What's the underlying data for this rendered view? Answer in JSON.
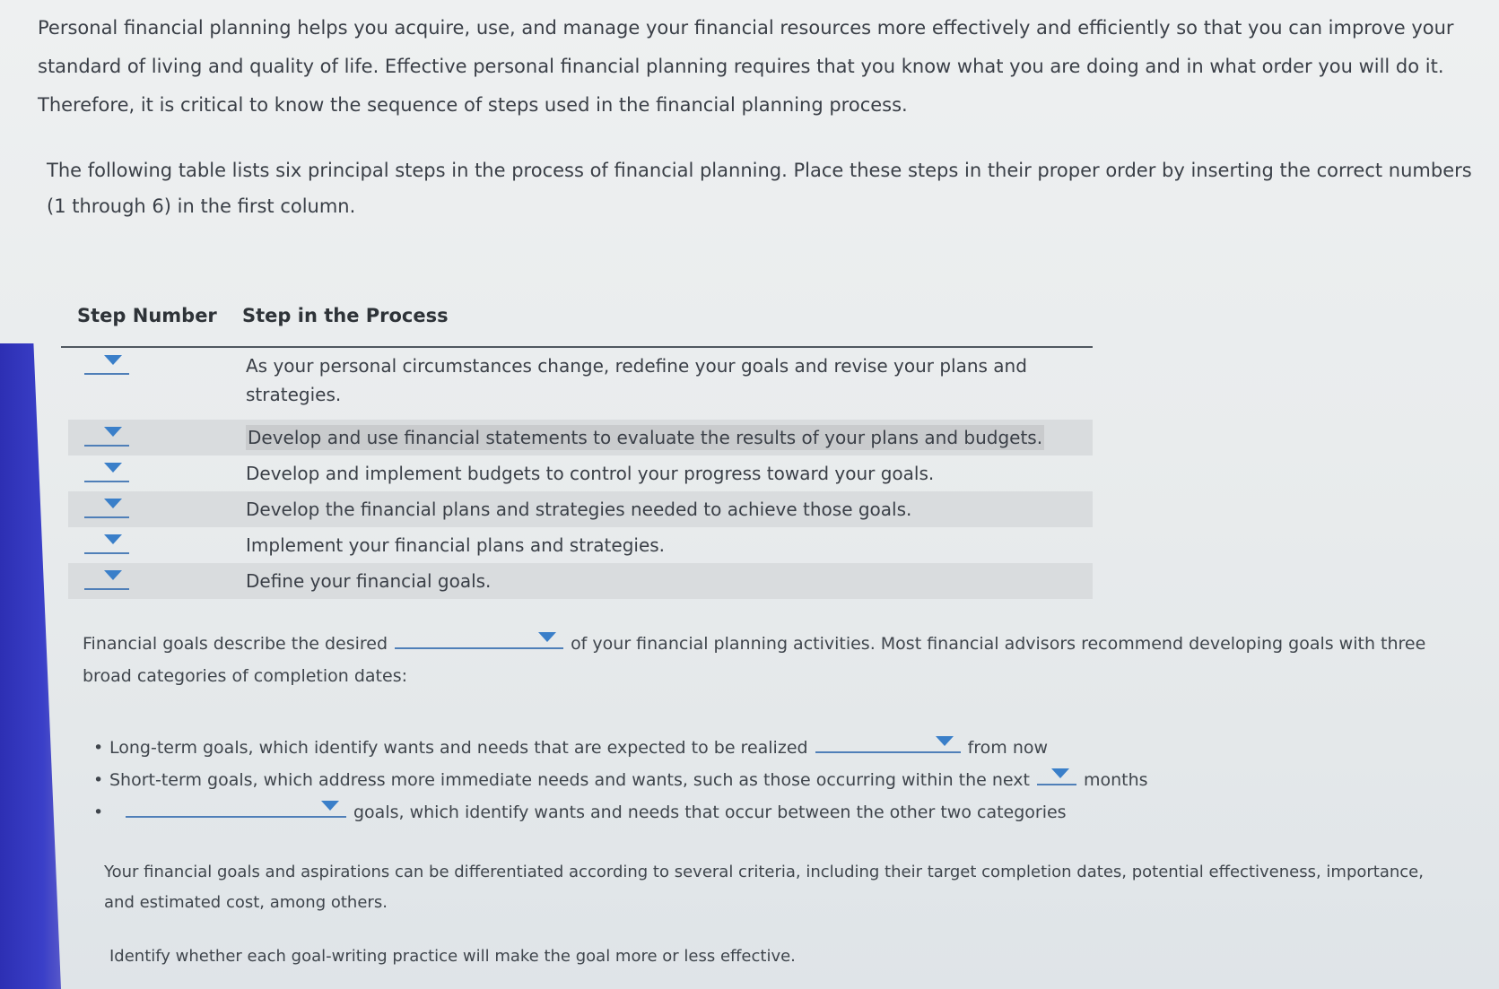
{
  "intro": {
    "paragraph": "Personal financial planning helps you acquire, use, and manage your financial resources more effectively and efficiently so that you can improve your standard of living and quality of life. Effective personal financial planning requires that you know what you are doing and in what order you will do it. Therefore, it is critical to know the sequence of steps used in the financial planning process."
  },
  "instructions": {
    "paragraph": "The following table lists six principal steps in the process of financial planning. Place these steps in their proper order by inserting the correct numbers (1 through 6) in the first column."
  },
  "table": {
    "headers": {
      "step_number": "Step Number",
      "step_process": "Step in the Process"
    },
    "rows": [
      {
        "step": "As your personal circumstances change, redefine your goals and revise your plans and strategies."
      },
      {
        "step": "Develop and use financial statements to evaluate the results of your plans and budgets."
      },
      {
        "step": "Develop and implement budgets to control your progress toward your goals."
      },
      {
        "step": "Develop the financial plans and strategies needed to achieve those goals."
      },
      {
        "step": "Implement your financial plans and strategies."
      },
      {
        "step": "Define your financial goals."
      }
    ]
  },
  "goals": {
    "text_before": "Financial goals describe the desired",
    "text_after": "of your financial planning activities. Most financial advisors recommend developing goals with three broad categories of completion dates:"
  },
  "goal_list": {
    "long_term_before": "Long-term goals, which identify wants and needs that are expected to be realized",
    "long_term_after": "from now",
    "short_term_before": "Short-term goals, which address more immediate needs and wants, such as those occurring within the next",
    "short_term_after": "months",
    "intermediate_after": "goals, which identify wants and needs that occur between the other two categories"
  },
  "criteria": {
    "paragraph": "Your financial goals and aspirations can be differentiated according to several criteria, including their target completion dates, potential effectiveness, importance, and estimated cost, among others."
  },
  "identify": {
    "paragraph": "Identify whether each goal-writing practice will make the goal more or less effective."
  },
  "colors": {
    "dropdown_accent": "#3a7fc9",
    "bezel": "#3a3fc8"
  },
  "icons": {
    "dropdown": "caret-down-icon"
  }
}
